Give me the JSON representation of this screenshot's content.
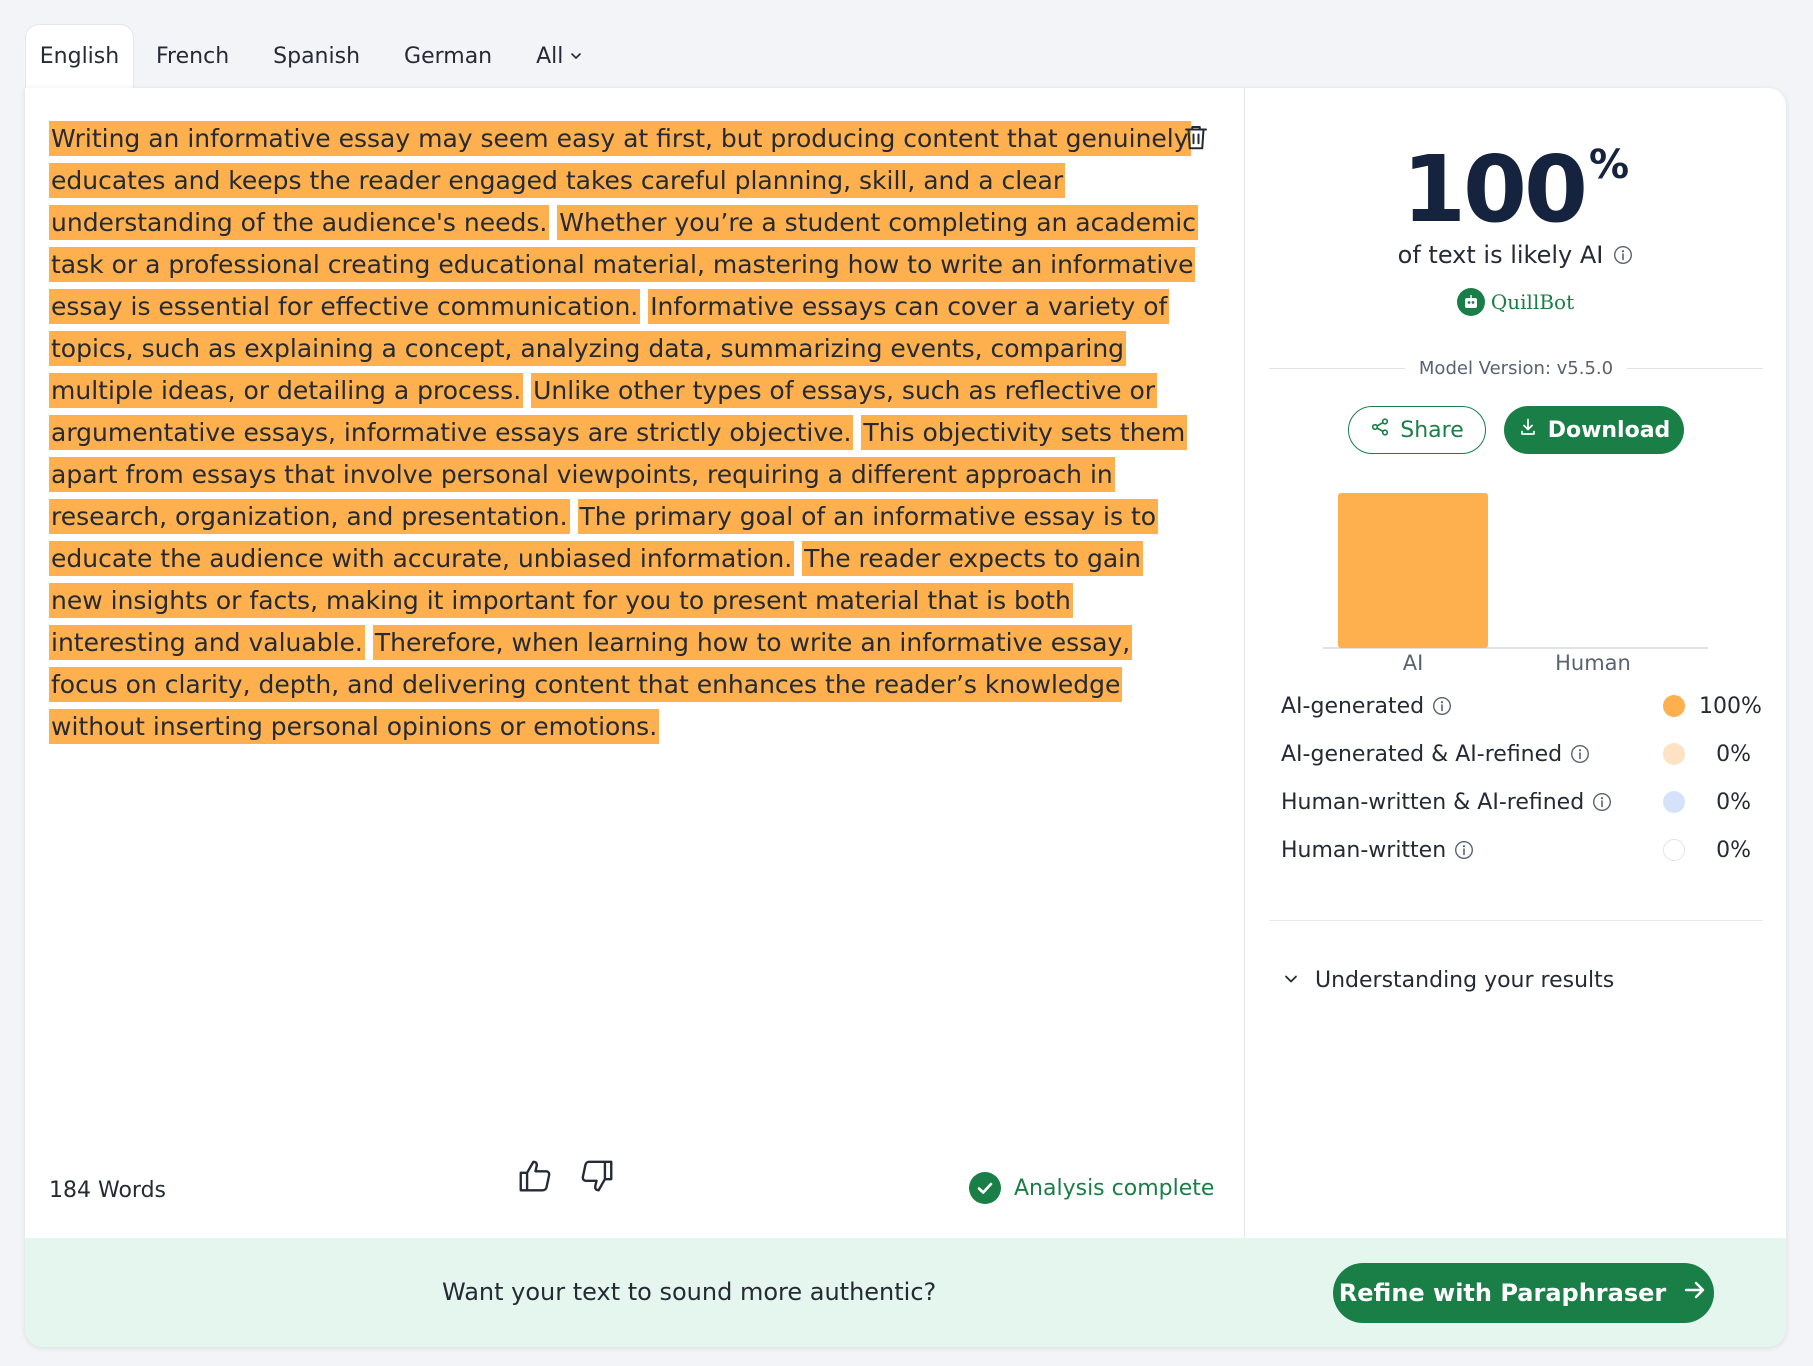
{
  "tabs": [
    {
      "label": "English",
      "active": true
    },
    {
      "label": "French"
    },
    {
      "label": "Spanish"
    },
    {
      "label": "German"
    },
    {
      "label": "All"
    }
  ],
  "editor": {
    "sentences": [
      "Writing an informative essay may seem easy at first, but producing content that genuinely educates and keeps the reader engaged takes careful planning, skill, and a clear understanding of the audience's needs.",
      "Whether you’re a student completing an academic task or a professional creating educational material, mastering how to write an informative essay is essential for effective communication.",
      "Informative essays can cover a variety of topics, such as explaining a concept, analyzing data, summarizing events, comparing multiple ideas, or detailing a process.",
      "Unlike other types of essays, such as reflective or argumentative essays, informative essays are strictly objective.",
      "This objectivity sets them apart from essays that involve personal viewpoints, requiring a different approach in research, organization, and presentation.",
      "The primary goal of an informative essay is to educate the audience with accurate, unbiased information.",
      "The reader expects to gain new insights or facts, making it important for you to present material that is both interesting and valuable.",
      "Therefore, when learning how to write an informative essay, focus on clarity, depth, and delivering content that enhances the reader’s knowledge without inserting personal opinions or emotions."
    ],
    "highlight_color": "#fdb04d",
    "word_count": "184 Words",
    "status": "Analysis complete"
  },
  "results": {
    "score": "100",
    "score_unit": "%",
    "score_label": "of text is likely AI",
    "brand": "QuillBot",
    "model_version": "Model Version: v5.5.0",
    "share_label": "Share",
    "download_label": "Download",
    "breakdown": [
      {
        "label": "AI-generated",
        "value": "100%",
        "color": "#fdb04d"
      },
      {
        "label": "AI-generated & AI-refined",
        "value": "0%",
        "color": "#fde3c3"
      },
      {
        "label": "Human-written & AI-refined",
        "value": "0%",
        "color": "#d5e2fa"
      },
      {
        "label": "Human-written",
        "value": "0%",
        "color": "#ffffff"
      }
    ],
    "understanding_label": "Understanding your results"
  },
  "chart_data": {
    "type": "bar",
    "categories": [
      "AI",
      "Human"
    ],
    "values": [
      100,
      0
    ],
    "ylim": [
      0,
      100
    ],
    "colors": [
      "#fdb04d",
      "#c9d3e3"
    ]
  },
  "banner": {
    "text": "Want your text to sound more authentic?",
    "button_label": "Refine with Paraphraser"
  },
  "colors": {
    "brand_green": "#1a7e47",
    "ai_orange": "#fdb04d",
    "banner_bg": "#e4f6ee",
    "score_navy": "#15233e"
  }
}
